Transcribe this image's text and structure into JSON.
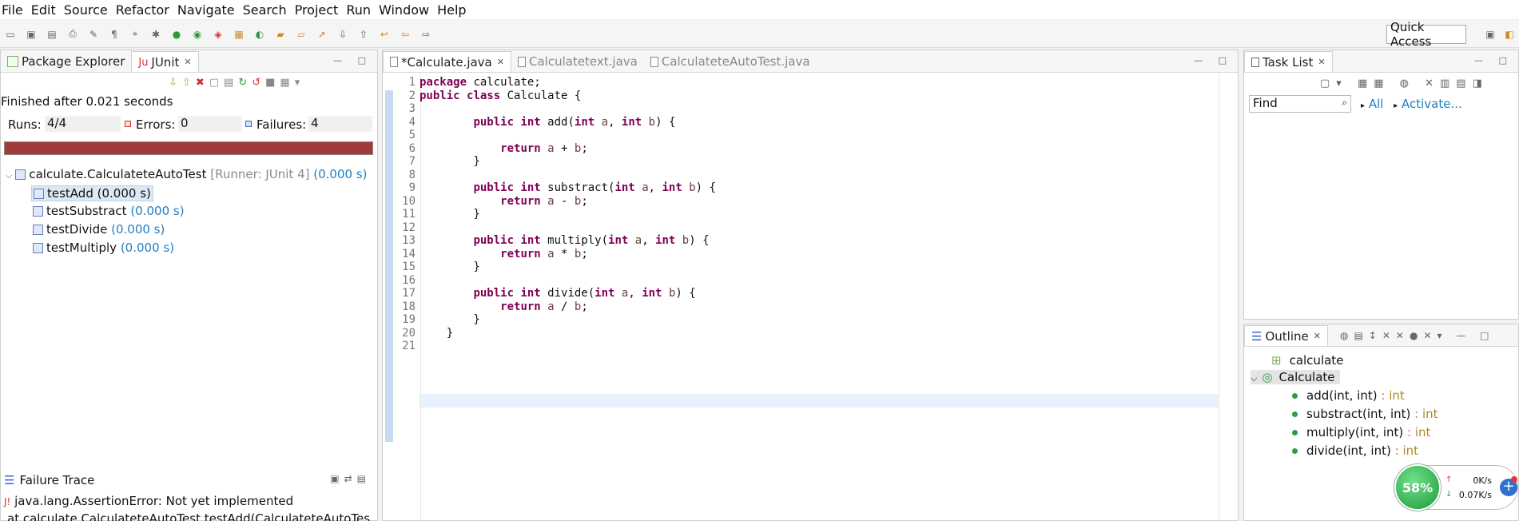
{
  "menu": [
    "File",
    "Edit",
    "Source",
    "Refactor",
    "Navigate",
    "Search",
    "Project",
    "Run",
    "Window",
    "Help"
  ],
  "quick_access": "Quick Access",
  "left_tabs": {
    "package_explorer": "Package Explorer",
    "junit": "JUnit"
  },
  "junit": {
    "status": "Finished after 0.021 seconds",
    "runs_label": "Runs:",
    "runs_value": "4/4",
    "errors_label": "Errors:",
    "errors_value": "0",
    "failures_label": "Failures:",
    "failures_value": "4",
    "bar_color": "#a33a3a",
    "suite_name": "calculate.CalculateteAutoTest",
    "suite_runner": "[Runner: JUnit 4]",
    "suite_time": "(0.000 s)",
    "tests": [
      {
        "name": "testAdd",
        "time": "(0.000 s)"
      },
      {
        "name": "testSubstract",
        "time": "(0.000 s)"
      },
      {
        "name": "testDivide",
        "time": "(0.000 s)"
      },
      {
        "name": "testMultiply",
        "time": "(0.000 s)"
      }
    ],
    "failure_trace_label": "Failure Trace",
    "failure_line1": "java.lang.AssertionError: Not yet implemented",
    "failure_line2": "at calculate.CalculateteAutoTest.testAdd(CalculateteAutoTes"
  },
  "editor_tabs": [
    "*Calculate.java",
    "Calculatetext.java",
    "CalculateteAutoTest.java"
  ],
  "line_numbers": [
    "1",
    "2",
    "3",
    "4",
    "5",
    "6",
    "7",
    "8",
    "9",
    "10",
    "11",
    "12",
    "13",
    "14",
    "15",
    "16",
    "17",
    "18",
    "19",
    "20",
    "21"
  ],
  "task_list": {
    "title": "Task List",
    "find_placeholder": "Find",
    "all": "All",
    "activate": "Activate..."
  },
  "outline": {
    "title": "Outline",
    "package": "calculate",
    "class": "Calculate",
    "methods": [
      {
        "sig": "add(int, int)",
        "type": ": int"
      },
      {
        "sig": "substract(int, int)",
        "type": ": int"
      },
      {
        "sig": "multiply(int, int)",
        "type": ": int"
      },
      {
        "sig": "divide(int, int)",
        "type": ": int"
      }
    ]
  },
  "widget": {
    "percent": "58%",
    "up": "0K/s",
    "down": "0.07K/s"
  }
}
